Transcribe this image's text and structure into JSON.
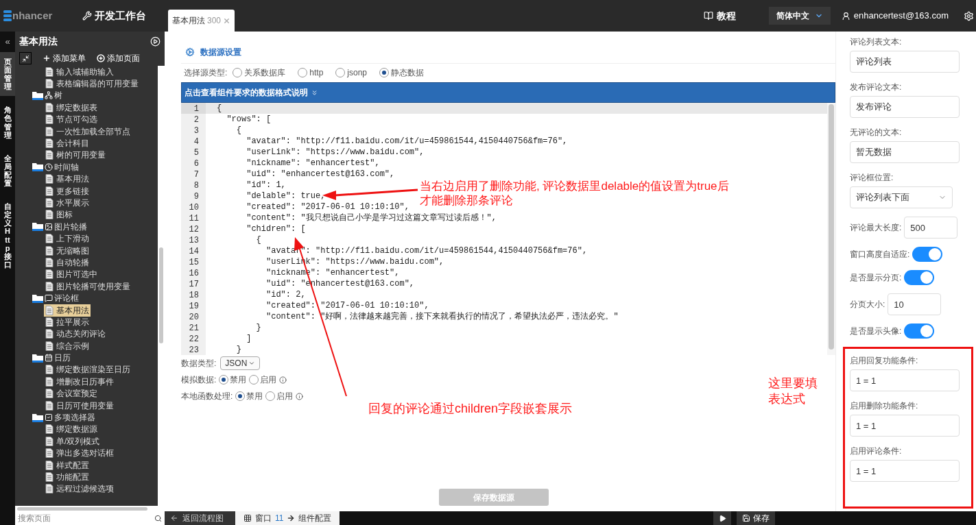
{
  "topbar": {
    "logo": "nhancer",
    "workbench": "开发工作台",
    "tab": {
      "label": "基本用法",
      "count": "300"
    },
    "tutorial": "教程",
    "language": "简体中文",
    "user": "enhancertest@163.com"
  },
  "side_tabs": [
    {
      "label": "页面管理",
      "selected": true
    },
    {
      "label": "角色管理",
      "selected": false
    },
    {
      "label": "全局配置",
      "selected": false
    },
    {
      "label": "自定义 Http 接口",
      "selected": false
    }
  ],
  "sidebar": {
    "collapse": "«",
    "title": "基本用法",
    "actions": [
      "添加菜单",
      "添加页面"
    ],
    "search": {
      "placeholder": "搜索页面"
    },
    "tree": [
      {
        "kind": "page",
        "label": "输入域辅助输入",
        "selected": false
      },
      {
        "kind": "page",
        "label": "表格编辑器的可用变量",
        "selected": false
      },
      {
        "kind": "folder",
        "label": "树",
        "children": [
          {
            "kind": "page",
            "label": "绑定数据表",
            "selected": false
          },
          {
            "kind": "page",
            "label": "节点可勾选",
            "selected": false
          },
          {
            "kind": "page",
            "label": "一次性加载全部节点",
            "selected": false
          },
          {
            "kind": "page",
            "label": "会计科目",
            "selected": false
          },
          {
            "kind": "page",
            "label": "树的可用变量",
            "selected": false
          }
        ]
      },
      {
        "kind": "folder",
        "label": "时间轴",
        "children": [
          {
            "kind": "page",
            "label": "基本用法",
            "selected": false
          },
          {
            "kind": "page",
            "label": "更多链接",
            "selected": false
          },
          {
            "kind": "page",
            "label": "水平展示",
            "selected": false
          },
          {
            "kind": "page",
            "label": "图标",
            "selected": false
          }
        ]
      },
      {
        "kind": "folder",
        "label": "图片轮播",
        "children": [
          {
            "kind": "page",
            "label": "上下滑动",
            "selected": false
          },
          {
            "kind": "page",
            "label": "无缩略图",
            "selected": false
          },
          {
            "kind": "page",
            "label": "自动轮播",
            "selected": false
          },
          {
            "kind": "page",
            "label": "图片可选中",
            "selected": false
          },
          {
            "kind": "page",
            "label": "图片轮播可使用变量",
            "selected": false
          }
        ]
      },
      {
        "kind": "folder",
        "label": "评论框",
        "children": [
          {
            "kind": "page",
            "label": "基本用法",
            "selected": true
          },
          {
            "kind": "page",
            "label": "拉平展示",
            "selected": false
          },
          {
            "kind": "page",
            "label": "动态关闭评论",
            "selected": false
          },
          {
            "kind": "page",
            "label": "综合示例",
            "selected": false
          }
        ]
      },
      {
        "kind": "folder",
        "label": "日历",
        "children": [
          {
            "kind": "page",
            "label": "绑定数据渲染至日历",
            "selected": false
          },
          {
            "kind": "page",
            "label": "增删改日历事件",
            "selected": false
          },
          {
            "kind": "page",
            "label": "会议室预定",
            "selected": false
          },
          {
            "kind": "page",
            "label": "日历可使用变量",
            "selected": false
          }
        ]
      },
      {
        "kind": "folder",
        "label": "多项选择器",
        "children": [
          {
            "kind": "page",
            "label": "绑定数据源",
            "selected": false
          },
          {
            "kind": "page",
            "label": "单/双列模式",
            "selected": false
          },
          {
            "kind": "page",
            "label": "弹出多选对话框",
            "selected": false
          },
          {
            "kind": "page",
            "label": "样式配置",
            "selected": false
          },
          {
            "kind": "page",
            "label": "功能配置",
            "selected": false
          },
          {
            "kind": "page",
            "label": "远程过滤候选项",
            "selected": false
          }
        ]
      }
    ]
  },
  "datasource": {
    "title": "数据源设置",
    "source_type": {
      "label": "选择源类型:",
      "options": [
        {
          "label": "关系数据库",
          "selected": false
        },
        {
          "label": "http",
          "selected": false
        },
        {
          "label": "jsonp",
          "selected": false
        },
        {
          "label": "静态数据",
          "selected": true
        }
      ]
    },
    "format_bar": "点击查看组件要求的数据格式说明",
    "code_lines": [
      {
        "number": "1",
        "text": "{",
        "current": true
      },
      {
        "number": "2",
        "text": "  \"rows\": [",
        "current": false
      },
      {
        "number": "3",
        "text": "    {",
        "current": false
      },
      {
        "number": "4",
        "text": "      \"avatar\": \"http://f11.baidu.com/it/u=459861544,4150440756&fm=76\",",
        "current": false
      },
      {
        "number": "5",
        "text": "      \"userLink\": \"https://www.baidu.com\",",
        "current": false
      },
      {
        "number": "6",
        "text": "      \"nickname\": \"enhancertest\",",
        "current": false
      },
      {
        "number": "7",
        "text": "      \"uid\": \"enhancertest@163.com\",",
        "current": false
      },
      {
        "number": "8",
        "text": "      \"id\": 1,",
        "current": false
      },
      {
        "number": "9",
        "text": "      \"delable\": true,",
        "current": false
      },
      {
        "number": "10",
        "text": "      \"created\": \"2017-06-01 10:10:10\",",
        "current": false
      },
      {
        "number": "11",
        "text": "      \"content\": \"我只想说自己小学是学习过这篇文章写过读后感！\",",
        "current": false
      },
      {
        "number": "12",
        "text": "      \"chidren\": [",
        "current": false
      },
      {
        "number": "13",
        "text": "        {",
        "current": false
      },
      {
        "number": "14",
        "text": "          \"avatar\": \"http://f11.baidu.com/it/u=459861544,4150440756&fm=76\",",
        "current": false
      },
      {
        "number": "15",
        "text": "          \"userLink\": \"https://www.baidu.com\",",
        "current": false
      },
      {
        "number": "16",
        "text": "          \"nickname\": \"enhancertest\",",
        "current": false
      },
      {
        "number": "17",
        "text": "          \"uid\": \"enhancertest@163.com\",",
        "current": false
      },
      {
        "number": "18",
        "text": "          \"id\": 2,",
        "current": false
      },
      {
        "number": "19",
        "text": "          \"created\": \"2017-06-01 10:10:10\",",
        "current": false
      },
      {
        "number": "20",
        "text": "          \"content\": \"好啊，法律越来越完善，接下来就看执行的情况了，希望执法必严，违法必究。\"",
        "current": false
      },
      {
        "number": "21",
        "text": "        }",
        "current": false
      },
      {
        "number": "22",
        "text": "      ]",
        "current": false
      },
      {
        "number": "23",
        "text": "    }",
        "current": false
      }
    ],
    "data_type": {
      "label": "数据类型:",
      "value": "JSON"
    },
    "switches": [
      {
        "label": "模拟数据:",
        "choices": [
          {
            "label": "禁用",
            "selected": true
          },
          {
            "label": "启用",
            "selected": false
          }
        ]
      },
      {
        "label": "本地函数处理:",
        "choices": [
          {
            "label": "禁用",
            "selected": true
          },
          {
            "label": "启用",
            "selected": false
          }
        ]
      }
    ],
    "save_button": {
      "label": "保存数据源",
      "disabled": true
    }
  },
  "settings": [
    {
      "kind": "text",
      "label": "评论列表文本:",
      "value": "评论列表"
    },
    {
      "kind": "text",
      "label": "发布评论文本:",
      "value": "发布评论"
    },
    {
      "kind": "text",
      "label": "无评论的文本:",
      "value": "暂无数据"
    },
    {
      "kind": "select",
      "label": "评论框位置:",
      "value": "评论列表下面"
    },
    {
      "kind": "inline",
      "label": "评论最大长度:",
      "value": "500"
    },
    {
      "kind": "toggle",
      "label": "窗口高度自适应:",
      "on": true
    },
    {
      "kind": "toggle",
      "label": "是否显示分页:",
      "on": true
    },
    {
      "kind": "inline",
      "label": "分页大小:",
      "value": "10"
    },
    {
      "kind": "toggle",
      "label": "是否显示头像:",
      "on": true
    }
  ],
  "settings_highlighted": [
    {
      "kind": "text",
      "label": "启用回复功能条件:",
      "value": "1 = 1"
    },
    {
      "kind": "text",
      "label": "启用删除功能条件:",
      "value": "1 = 1"
    },
    {
      "kind": "text",
      "label": "启用评论条件:",
      "value": "1 = 1"
    }
  ],
  "annotations": [
    {
      "lines": [
        "当右边启用了删除功能, 评论数据里delable的值设置为true后",
        "才能删除那条评论"
      ]
    },
    {
      "lines": [
        "回复的评论通过children字段嵌套展示"
      ]
    },
    {
      "lines": [
        "这里要填",
        "表达式"
      ]
    }
  ],
  "bottom_bar": {
    "back": "返回流程图",
    "window_label": "窗口",
    "window_number": "11",
    "component": "组件配置",
    "save": "保存"
  }
}
